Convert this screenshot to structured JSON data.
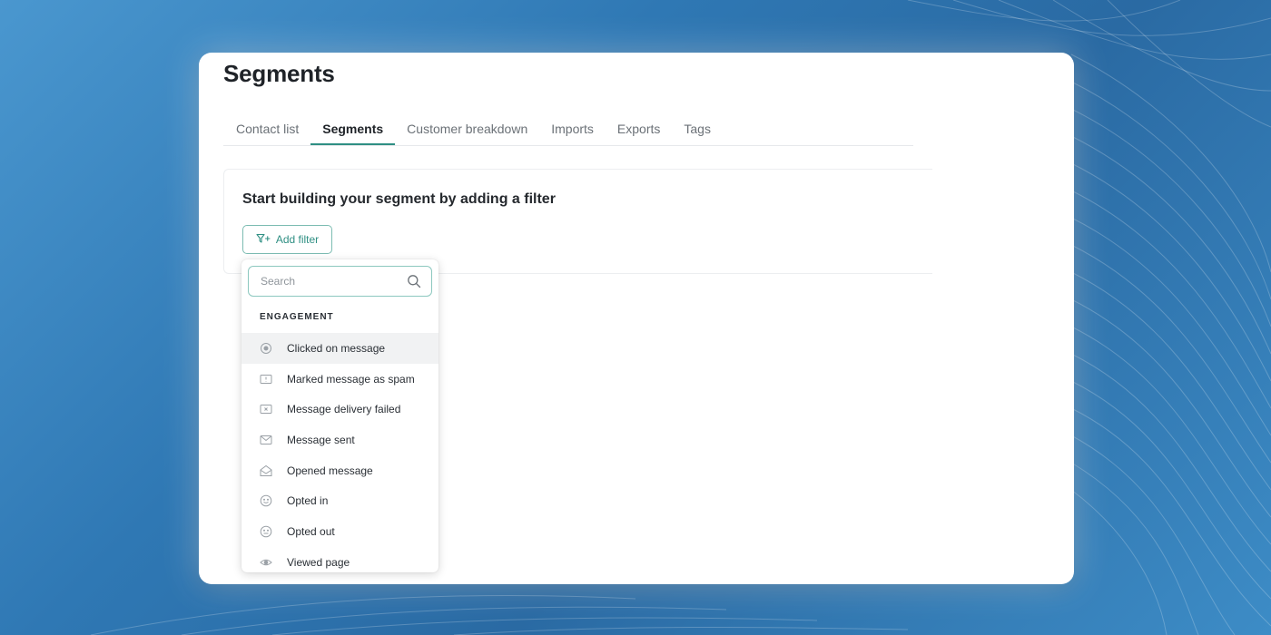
{
  "page": {
    "title": "Segments"
  },
  "tabs": [
    {
      "label": "Contact list",
      "active": false
    },
    {
      "label": "Segments",
      "active": true
    },
    {
      "label": "Customer breakdown",
      "active": false
    },
    {
      "label": "Imports",
      "active": false
    },
    {
      "label": "Exports",
      "active": false
    },
    {
      "label": "Tags",
      "active": false
    }
  ],
  "builder": {
    "heading": "Start building your segment by adding a filter",
    "add_filter_label": "Add filter",
    "add_filter_icon": "filter-plus-icon"
  },
  "dropdown": {
    "search_placeholder": "Search",
    "search_value": "",
    "section_label": "ENGAGEMENT",
    "items": [
      {
        "label": "Clicked on message",
        "icon": "click-target-icon",
        "highlighted": true
      },
      {
        "label": "Marked message as spam",
        "icon": "spam-flag-icon",
        "highlighted": false
      },
      {
        "label": "Message delivery failed",
        "icon": "delivery-failed-icon",
        "highlighted": false
      },
      {
        "label": "Message sent",
        "icon": "envelope-icon",
        "highlighted": false
      },
      {
        "label": "Opened message",
        "icon": "open-envelope-icon",
        "highlighted": false
      },
      {
        "label": "Opted in",
        "icon": "smile-face-icon",
        "highlighted": false
      },
      {
        "label": "Opted out",
        "icon": "neutral-face-icon",
        "highlighted": false
      },
      {
        "label": "Viewed page",
        "icon": "eye-icon",
        "highlighted": false
      }
    ]
  },
  "colors": {
    "accent": "#2f8f83",
    "accent_border": "#7cbcb2",
    "background_blue": "#2f78b4"
  }
}
